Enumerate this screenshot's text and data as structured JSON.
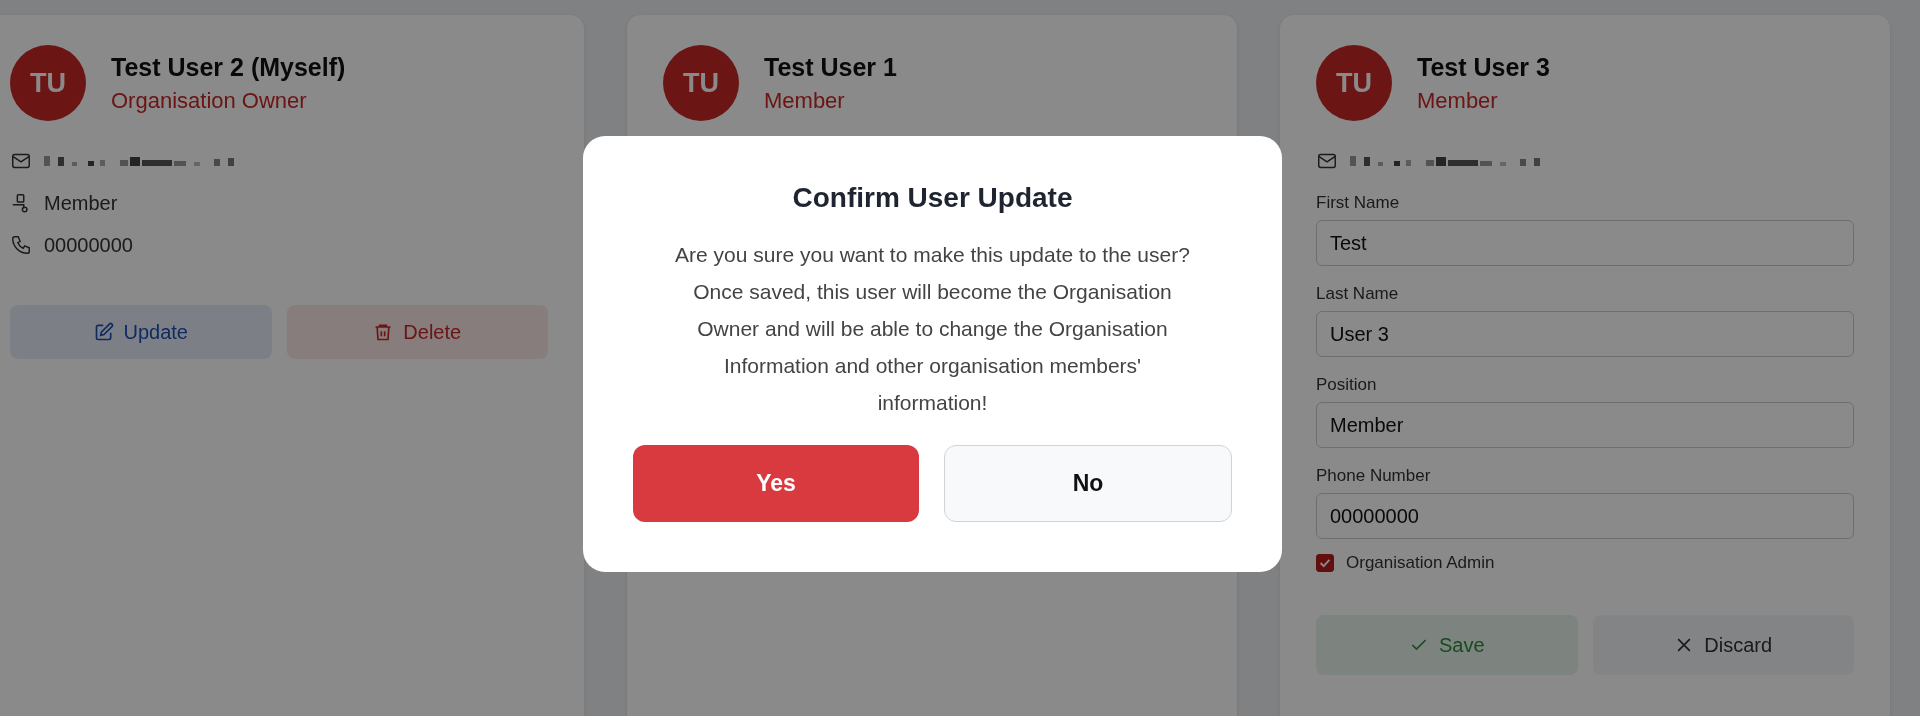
{
  "cards": [
    {
      "initials": "TU",
      "name": "Test User 2 (Myself)",
      "role": "Organisation Owner",
      "kind": "view",
      "details": [
        {
          "kind": "email"
        },
        {
          "kind": "position",
          "text": "Member"
        },
        {
          "kind": "phone",
          "text": "00000000"
        }
      ],
      "actions": [
        {
          "kind": "update",
          "label": "Update"
        },
        {
          "kind": "delete",
          "label": "Delete"
        }
      ]
    },
    {
      "initials": "TU",
      "name": "Test User 1",
      "role": "Member"
    },
    {
      "initials": "TU",
      "name": "Test User 3",
      "role": "Member",
      "kind": "edit",
      "details": [
        {
          "kind": "email"
        }
      ],
      "fields": [
        {
          "label": "First Name",
          "value": "Test"
        },
        {
          "label": "Last Name",
          "value": "User 3"
        },
        {
          "label": "Position",
          "value": "Member"
        },
        {
          "label": "Phone Number",
          "value": "00000000"
        }
      ],
      "checkbox": {
        "label": "Organisation Admin",
        "checked": true
      },
      "actions": [
        {
          "kind": "save",
          "label": "Save"
        },
        {
          "kind": "discard",
          "label": "Discard"
        }
      ]
    }
  ],
  "dialog": {
    "title": "Confirm User Update",
    "message": "Are you sure you want to make this update to the user? Once saved, this user will become the Organisation Owner and will be able to change the Organisation Information and other organisation members' information!",
    "buttons": [
      {
        "kind": "primary",
        "label": "Yes"
      },
      {
        "kind": "secondary",
        "label": "No"
      }
    ]
  }
}
